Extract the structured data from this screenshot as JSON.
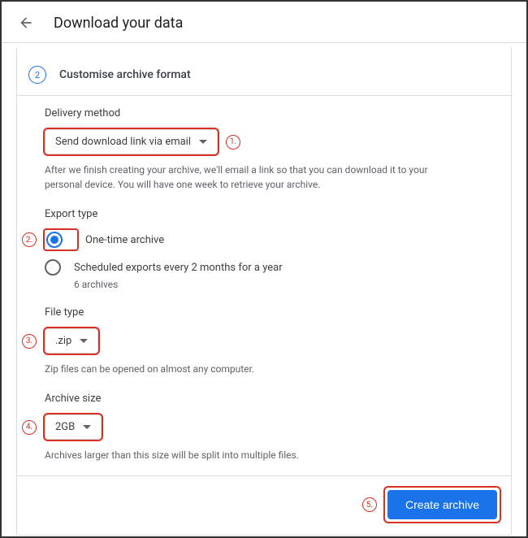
{
  "header": {
    "title": "Download your data"
  },
  "step": {
    "number": "2",
    "title": "Customise archive format"
  },
  "delivery": {
    "label": "Delivery method",
    "selected": "Send download link via email",
    "help": "After we finish creating your archive, we'll email a link so that you can download it to your personal device. You will have one week to retrieve your archive."
  },
  "export": {
    "label": "Export type",
    "options": [
      {
        "label": "One-time archive",
        "selected": true
      },
      {
        "label": "Scheduled exports every 2 months for a year",
        "sub": "6 archives",
        "selected": false
      }
    ]
  },
  "file_type": {
    "label": "File type",
    "selected": ".zip",
    "help": "Zip files can be opened on almost any computer."
  },
  "archive_size": {
    "label": "Archive size",
    "selected": "2GB",
    "help": "Archives larger than this size will be split into multiple files."
  },
  "footer": {
    "create_label": "Create archive"
  },
  "annotations": {
    "n1": "1.",
    "n2": "2.",
    "n3": "3.",
    "n4": "4.",
    "n5": "5."
  }
}
